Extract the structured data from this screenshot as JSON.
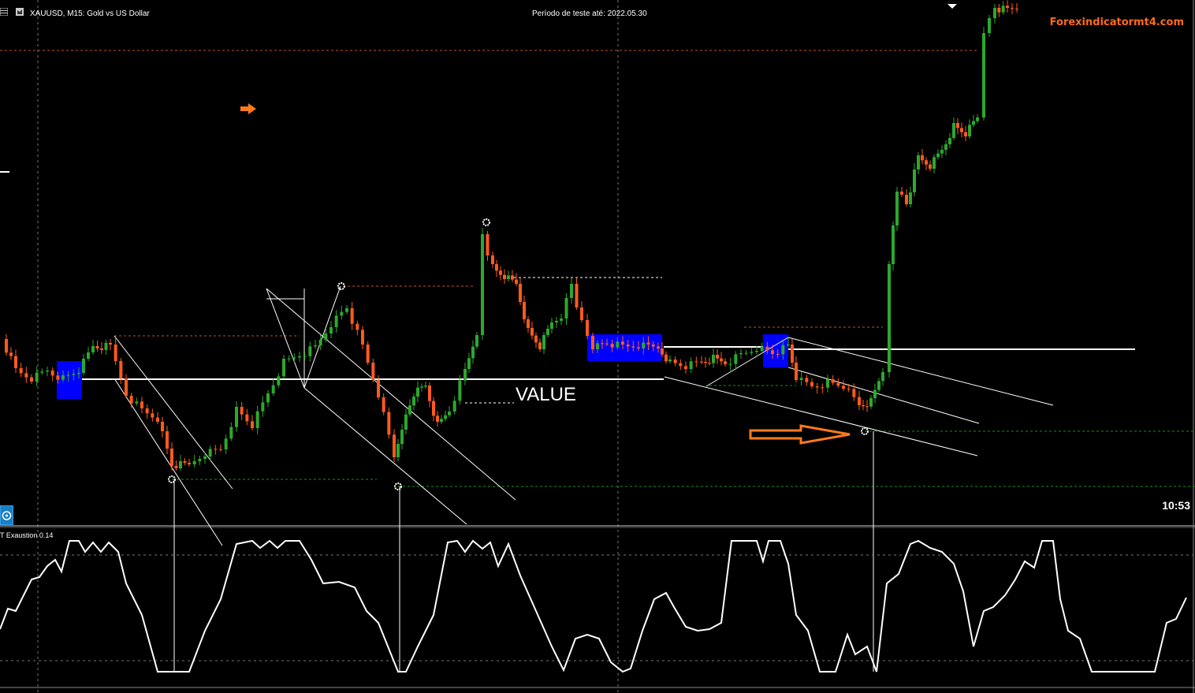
{
  "chart": {
    "symbol_title": "XAUUSD, M15:  Gold vs US Dollar",
    "test_period": "Período de teste até: 2022.05.30",
    "watermark": "Forexindicatormt4.com",
    "value_label": "VALUE",
    "clock": "10:53",
    "indicator_name": "T Exaustion 0.14"
  },
  "colors": {
    "background": "#000000",
    "bull_candle": "#2da82d",
    "bear_candle": "#ff5a1f",
    "zone": "#0000ff",
    "level_orange": "#c0502a",
    "level_green": "#1d8f1d",
    "line": "#ffffff",
    "arrow": "#ff7a1a"
  },
  "icons": {
    "menu": "grid-icon",
    "chart_type": "bar-chart-icon",
    "navigation": "crosshair-icon",
    "signal_arrow": "right-arrow-icon",
    "pivot": "gear-icon"
  }
}
